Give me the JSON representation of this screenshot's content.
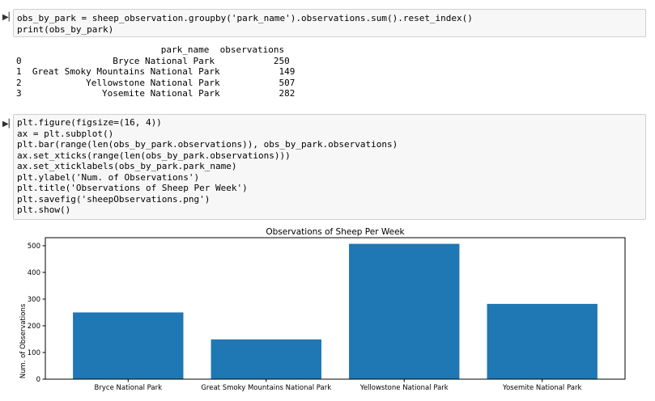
{
  "cell1": {
    "code_lines": [
      "obs_by_park = sheep_observation.groupby('park_name').observations.sum().reset_index()",
      "print(obs_by_park)"
    ],
    "output": {
      "header": "                           park_name  observations",
      "rows": [
        "0                 Bryce National Park           250",
        "1  Great Smoky Mountains National Park           149",
        "2            Yellowstone National Park           507",
        "3               Yosemite National Park           282"
      ]
    }
  },
  "cell2": {
    "code_lines": [
      "plt.figure(figsize=(16, 4))",
      "ax = plt.subplot()",
      "plt.bar(range(len(obs_by_park.observations)), obs_by_park.observations)",
      "ax.set_xticks(range(len(obs_by_park.observations)))",
      "ax.set_xticklabels(obs_by_park.park_name)",
      "plt.ylabel('Num. of Observations')",
      "plt.title('Observations of Sheep Per Week')",
      "plt.savefig('sheepObservations.png')",
      "plt.show()"
    ]
  },
  "run_icon": "run-cell-icon",
  "chart_data": {
    "type": "bar",
    "title": "Observations of Sheep Per Week",
    "xlabel": "",
    "ylabel": "Num. of Observations",
    "categories": [
      "Bryce National Park",
      "Great Smoky Mountains National Park",
      "Yellowstone National Park",
      "Yosemite National Park"
    ],
    "values": [
      250,
      149,
      507,
      282
    ],
    "ylim": [
      0,
      530
    ],
    "yticks": [
      0,
      100,
      200,
      300,
      400,
      500
    ],
    "grid": false,
    "bar_color": "#1f77b4"
  }
}
